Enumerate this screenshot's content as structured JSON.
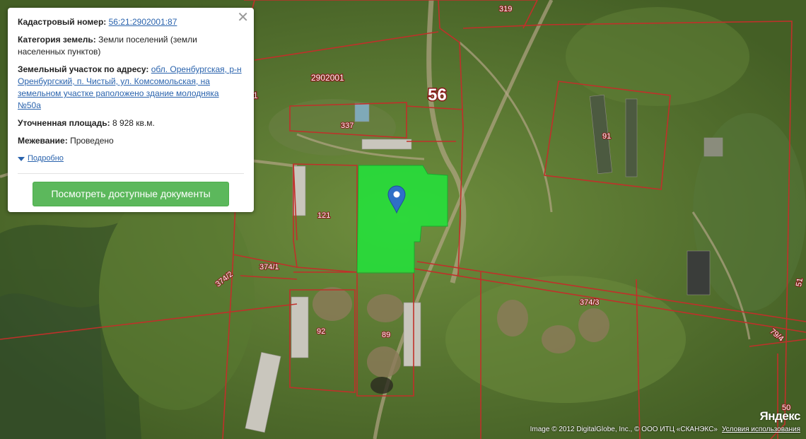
{
  "popup": {
    "cadastral_label": "Кадастровый номер:",
    "cadastral_value": "56:21:2902001:87",
    "category_label": "Категория земель:",
    "category_value": "Земли поселений (земли населенных пунктов)",
    "address_label": "Земельный участок по адресу:",
    "address_value": "обл. Оренбургская, р-н Оренбургский, п. Чистый, ул. Комсомольская, на земельном участке раположено здание молодняка №50а",
    "area_label": "Уточненная площадь:",
    "area_value": "8 928 кв.м.",
    "survey_label": "Межевание:",
    "survey_value": "Проведено",
    "more_link": "Подробно",
    "docs_button": "Посмотреть доступные документы",
    "close_icon": "close-icon"
  },
  "map": {
    "region_label": "56",
    "quarter_label": "2902001",
    "parcels": [
      "337",
      "121",
      "91",
      "92",
      "89",
      "374/1",
      "374/2",
      "374/3",
      "79/4",
      "319",
      "51",
      "50",
      "1"
    ],
    "colors": {
      "highlight": "#1fe83a",
      "boundary": "#c0302a",
      "marker": "#2f6fc7"
    }
  },
  "attribution": {
    "imagery": "Image © 2012 DigitalGlobe, Inc., © ООО ИТЦ «СКАНЭКС»",
    "terms": "Условия использования",
    "logo": "Яндекс"
  }
}
